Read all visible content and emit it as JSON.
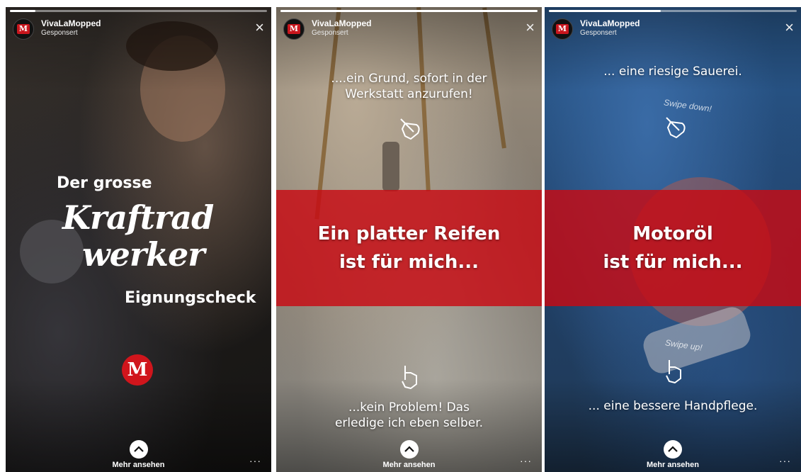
{
  "stories": [
    {
      "account_name": "VivaLaMopped",
      "account_sub": "Gesponsert",
      "avatar_letter": "M",
      "close_icon": "×",
      "progress": 0.1,
      "lines": [
        "Der grosse",
        "Kraftrad",
        "werker",
        "Eignungscheck"
      ],
      "brand_letter": "M",
      "more_label": "Mehr ansehen",
      "dots": "···"
    },
    {
      "account_name": "VivaLaMopped",
      "account_sub": "Gesponsert",
      "avatar_letter": "M",
      "close_icon": "×",
      "progress": 1.0,
      "top_text": [
        "....ein Grund, sofort in der",
        "Werkstatt anzurufen!"
      ],
      "main_text": [
        "Ein platter Reifen",
        "ist für mich..."
      ],
      "bottom_text": [
        "...kein Problem! Das",
        "erledige ich eben selber."
      ],
      "more_label": "Mehr ansehen",
      "dots": "···"
    },
    {
      "account_name": "VivaLaMopped",
      "account_sub": "Gesponsert",
      "avatar_letter": "M",
      "close_icon": "×",
      "progress": 0.45,
      "top_text": [
        "... eine riesige Sauerei."
      ],
      "swipe_down": "Swipe down!",
      "main_text": [
        "Motoröl",
        "ist für mich..."
      ],
      "swipe_up": "Swipe up!",
      "bottom_text": [
        "... eine bessere Handpflege."
      ],
      "more_label": "Mehr ansehen",
      "dots": "···"
    }
  ],
  "colors": {
    "accent_red": "#c8161d",
    "white": "#ffffff"
  },
  "icons": {
    "hand": "pointing-hand-icon",
    "more": "chevron-up-icon",
    "close": "close-icon"
  }
}
